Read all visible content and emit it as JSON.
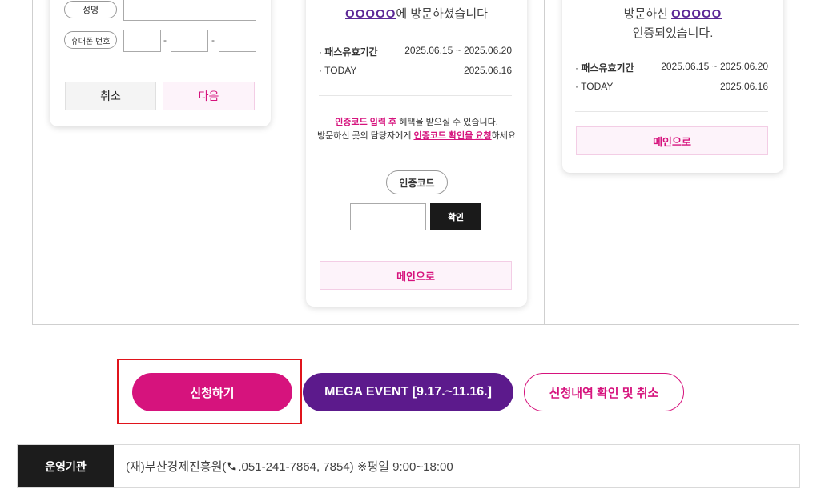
{
  "form_card": {
    "name_label": "성명",
    "phone_label": "휴대폰 번호",
    "phone_separator": "-",
    "cancel_label": "취소",
    "next_label": "다음"
  },
  "code_card": {
    "visit_place": "OOOOO",
    "visit_suffix": "에 방문하셨습니다",
    "pass_label": "패스유효기간",
    "pass_value": "2025.06.15 ~ 2025.06.20",
    "today_label": "TODAY",
    "today_value": "2025.06.16",
    "notice_line1_highlight": "인증코드 입력 후",
    "notice_line1_rest": " 혜택을 받으실 수 있습니다.",
    "notice_line2_prefix": "방문하신 곳의 담당자에게 ",
    "notice_line2_highlight": "인증코드 확인을 요청",
    "notice_line2_suffix": "하세요",
    "code_label": "인증코드",
    "confirm_label": "확인",
    "main_label": "메인으로"
  },
  "verified_card": {
    "visit_prefix": "방문하신 ",
    "visit_place": "OOOOO",
    "verified_text": "인증되었습니다.",
    "pass_label": "패스유효기간",
    "pass_value": "2025.06.15 ~ 2025.06.20",
    "today_label": "TODAY",
    "today_value": "2025.06.16",
    "main_label": "메인으로"
  },
  "actions": {
    "apply_label": "신청하기",
    "mega_event_label": "MEGA EVENT [9.17.~11.16.]",
    "history_label": "신청내역 확인 및 취소"
  },
  "footer": {
    "label": "운영기관",
    "text_prefix": "(재)부산경제진흥원(",
    "text_suffix": ".051-241-7864, 7854) ※평일 9:00~18:00"
  },
  "colors": {
    "primary_pink": "#d6137d",
    "purple": "#5c1a8c",
    "dark": "#1c1c1c",
    "highlight_red": "#e0141c"
  },
  "icons": {
    "phone": "phone-icon"
  }
}
